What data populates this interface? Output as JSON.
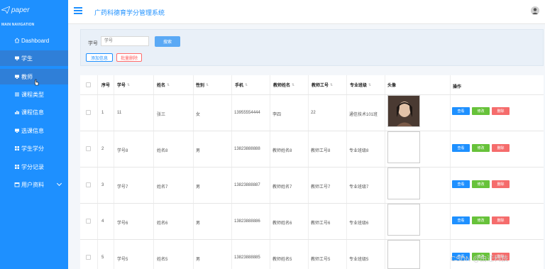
{
  "app": {
    "logo": "paper",
    "title": "广药科德育学分管理系统"
  },
  "sidebar": {
    "heading": "MAIN NAVIGATION",
    "items": [
      {
        "label": "Dashboard",
        "icon": "home-icon"
      },
      {
        "label": "学生",
        "icon": "monitor-icon"
      },
      {
        "label": "教师",
        "icon": "monitor-icon"
      },
      {
        "label": "课程类型",
        "icon": "list-icon"
      },
      {
        "label": "课程信息",
        "icon": "bar-chart-icon"
      },
      {
        "label": "选课信息",
        "icon": "monitor-icon"
      },
      {
        "label": "学生学分",
        "icon": "grid-icon"
      },
      {
        "label": "学分记录",
        "icon": "grid-icon"
      },
      {
        "label": "用户资料",
        "icon": "calendar-icon"
      }
    ]
  },
  "search": {
    "label": "学号",
    "placeholder": "学号",
    "button": "搜索"
  },
  "actions": {
    "add": "添加信息",
    "batch_delete": "批量删除"
  },
  "table": {
    "headers": [
      "序号",
      "学号",
      "姓名",
      "性别",
      "手机",
      "教师姓名",
      "教师工号",
      "专业班级",
      "头像",
      "操作"
    ],
    "rows": [
      {
        "idx": "1",
        "sno": "11",
        "name": "张三",
        "gender": "女",
        "phone": "13955554444",
        "tname": "李四",
        "tno": "22",
        "cls": "通信技术101班"
      },
      {
        "idx": "2",
        "sno": "学号8",
        "name": "姓名8",
        "gender": "男",
        "phone": "13823888888",
        "tname": "教师姓名8",
        "tno": "教师工号8",
        "cls": "专业班级8"
      },
      {
        "idx": "3",
        "sno": "学号7",
        "name": "姓名7",
        "gender": "男",
        "phone": "13823888887",
        "tname": "教师姓名7",
        "tno": "教师工号7",
        "cls": "专业班级7"
      },
      {
        "idx": "4",
        "sno": "学号6",
        "name": "姓名6",
        "gender": "男",
        "phone": "13823888886",
        "tname": "教师姓名6",
        "tno": "教师工号6",
        "cls": "专业班级6"
      },
      {
        "idx": "5",
        "sno": "学号5",
        "name": "姓名5",
        "gender": "男",
        "phone": "13823888885",
        "tname": "教师姓名5",
        "tno": "教师工号5",
        "cls": "专业班级5"
      }
    ],
    "buttons": {
      "view": "查看",
      "edit": "修改",
      "delete": "删除"
    }
  },
  "watermark": "CSDN @由迁科技",
  "colors": {
    "sidebar": "#1e90ff",
    "active": "#2f7fd8",
    "view": "#1e90ff",
    "edit": "#67c23a",
    "delete": "#f56c6c"
  }
}
